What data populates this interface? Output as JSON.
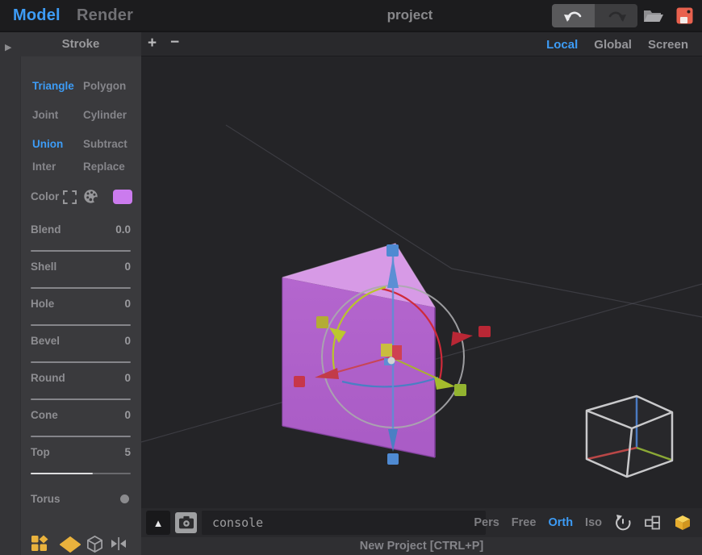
{
  "header": {
    "tabs": [
      {
        "label": "Model"
      },
      {
        "label": "Render"
      }
    ],
    "title": "project"
  },
  "toolbar_space": {
    "zoom_in": "+",
    "zoom_out": "−",
    "items": [
      {
        "label": "Local"
      },
      {
        "label": "Global"
      },
      {
        "label": "Screen"
      }
    ],
    "active": "Local"
  },
  "sidebar": {
    "title": "Stroke",
    "panel_toggle_glyph": "▶",
    "shape_rows": [
      {
        "left": "Triangle",
        "right": "Polygon"
      },
      {
        "left": "Joint",
        "right": "Cylinder"
      },
      {
        "left": "Union",
        "right": "Subtract"
      },
      {
        "left": "Inter",
        "right": "Replace"
      }
    ],
    "active_left_buttons": [
      "Triangle",
      "Union"
    ],
    "color": {
      "label": "Color",
      "swatch_hex": "#cb7bee"
    },
    "sliders": [
      {
        "label": "Blend",
        "value": "0.0"
      },
      {
        "label": "Shell",
        "value": "0"
      },
      {
        "label": "Hole",
        "value": "0"
      },
      {
        "label": "Bevel",
        "value": "0"
      },
      {
        "label": "Round",
        "value": "0"
      },
      {
        "label": "Cone",
        "value": "0"
      },
      {
        "label": "Top",
        "value": "5",
        "fill_style": "width:62%"
      }
    ],
    "torus": {
      "label": "Torus"
    }
  },
  "console": {
    "value": "console",
    "collapse_glyph": "▲"
  },
  "projections": {
    "items": [
      {
        "label": "Pers"
      },
      {
        "label": "Free"
      },
      {
        "label": "Orth"
      },
      {
        "label": "Iso"
      }
    ],
    "active": "Orth"
  },
  "status": {
    "text": "New Project [CTRL+P]"
  },
  "icons": {
    "undo": "undo-arrow",
    "redo": "redo-arrow",
    "open": "folder-open",
    "save": "floppy-disk",
    "pick": "corner-brackets",
    "palette": "paint-palette",
    "camera": "camera",
    "reset_view": "rotate-ccw",
    "quad_view": "layout-cells",
    "box_view": "yellow-cube",
    "shapes": "shapes-grid",
    "diamond": "diamond",
    "wire_cube": "wireframe-cube",
    "mirror": "mirror-triangles",
    "torus_toggle": "dot"
  },
  "colors": {
    "accent": "#3d9cf6",
    "swatch": "#cb7bee",
    "save_red": "#e8614e",
    "icon_orange": "#e9b23d",
    "prism_top": "#d79ae6",
    "prism_front": "#b164cc",
    "gizmo_red": "#cf2a3a",
    "gizmo_green": "#9ab52e",
    "gizmo_blue": "#4f8ad2",
    "gizmo_yellow": "#b3ac35"
  }
}
